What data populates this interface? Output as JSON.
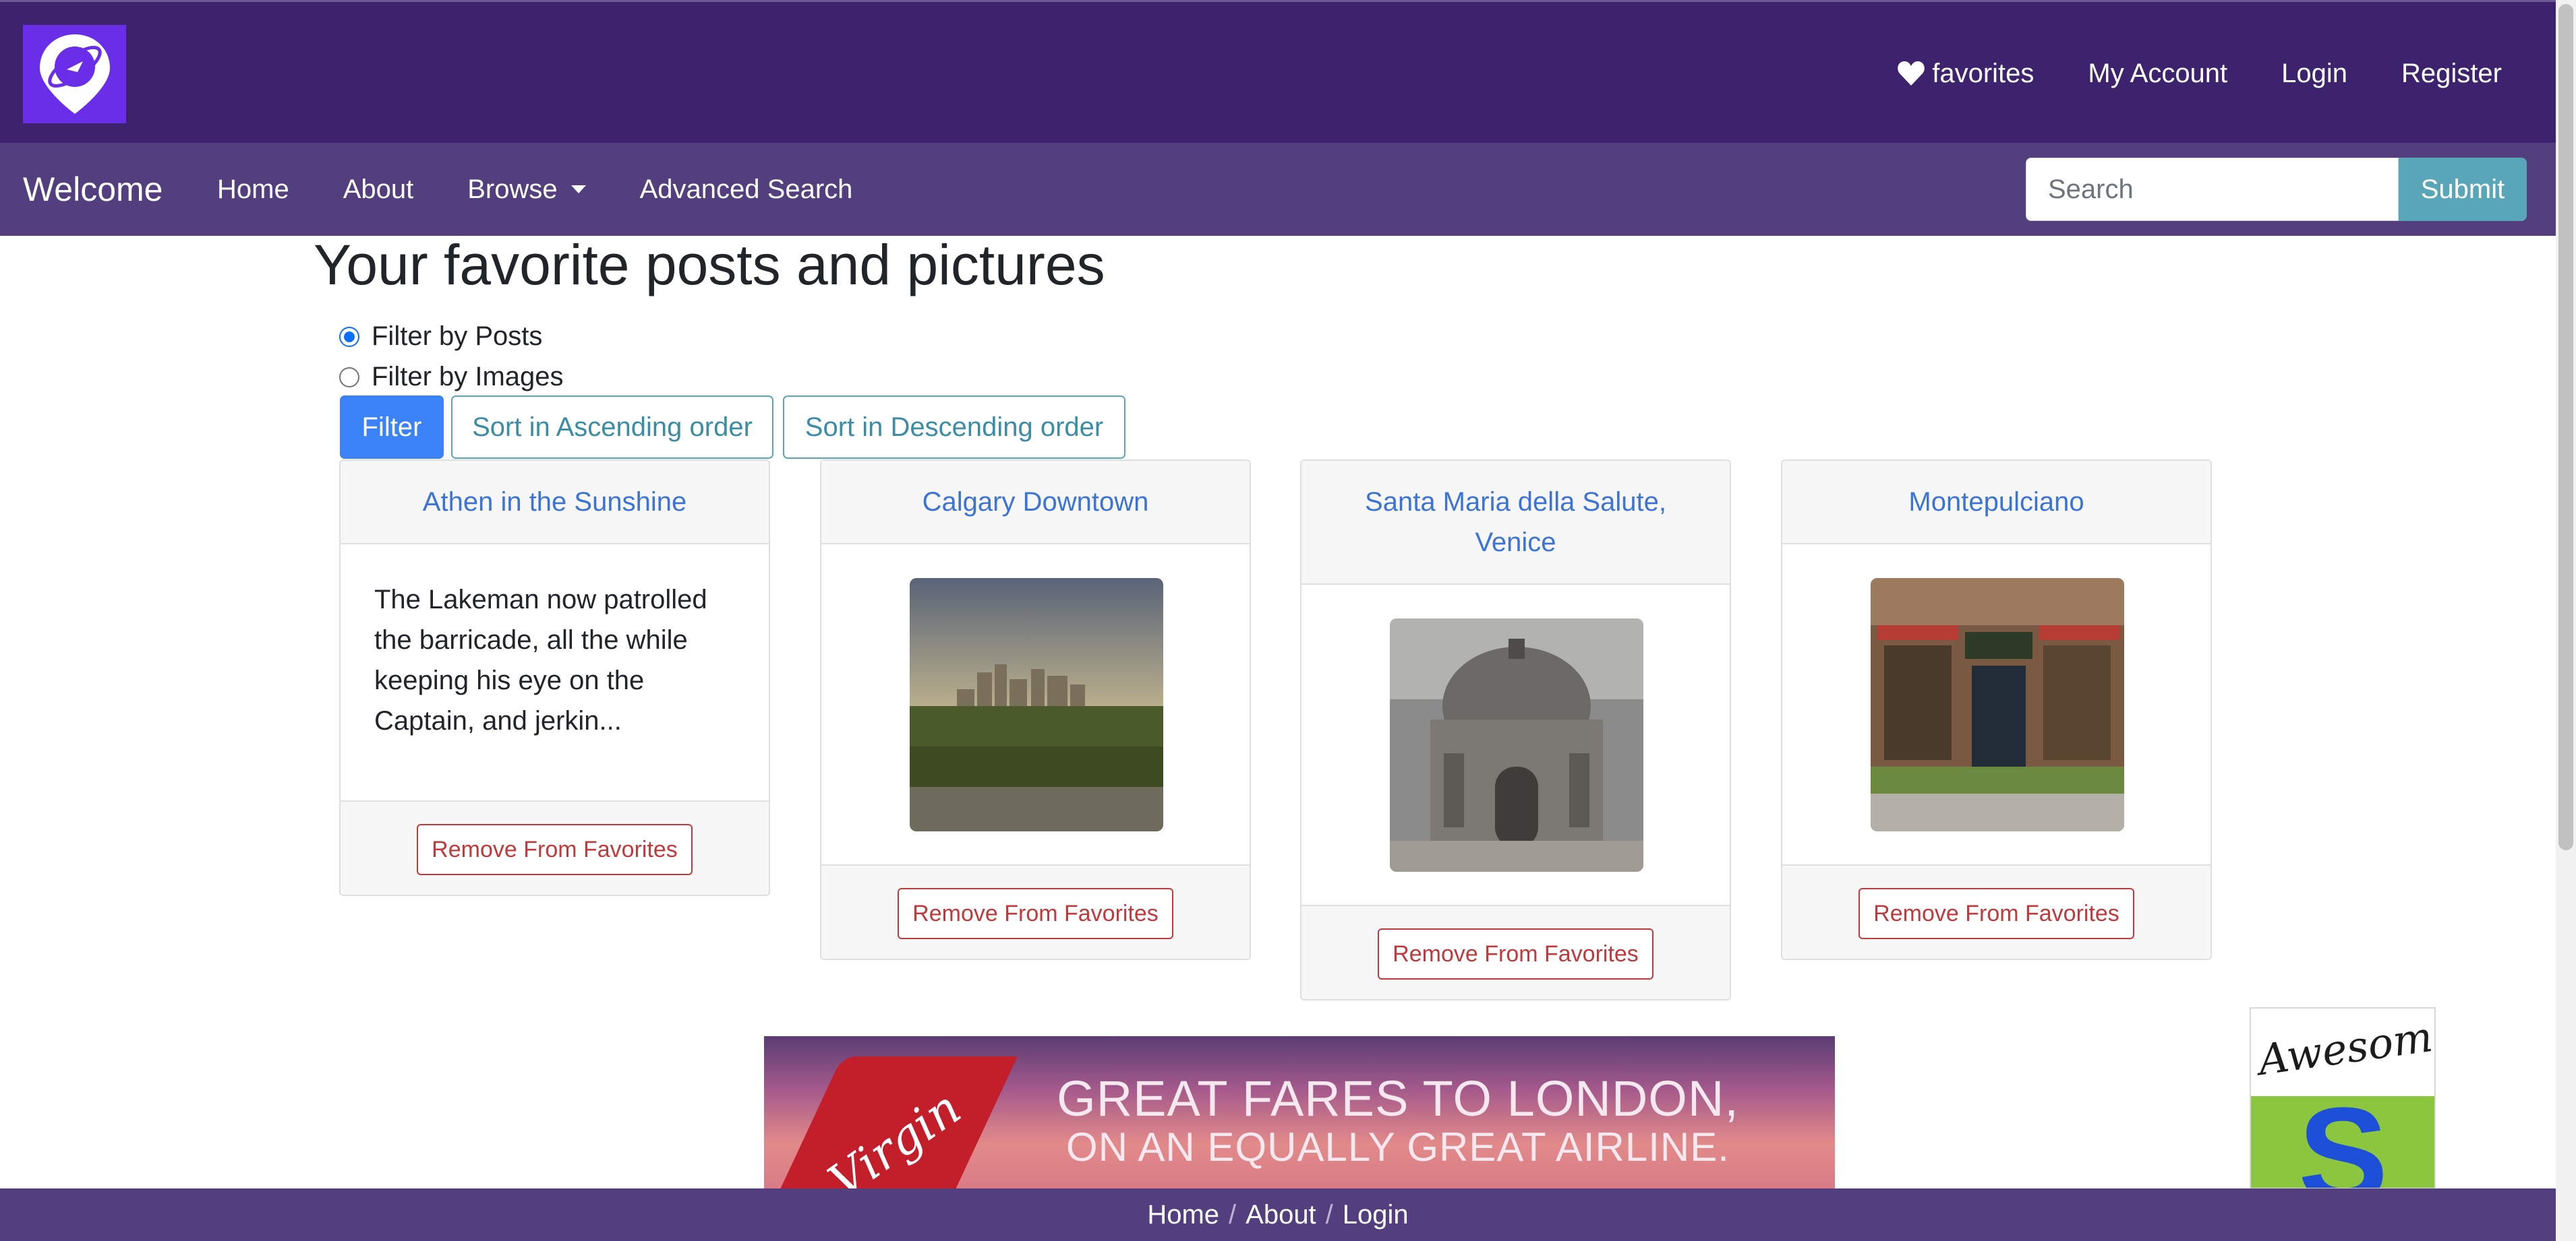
{
  "topbar": {
    "links": [
      {
        "label": "favorites",
        "icon": "heart-icon"
      },
      {
        "label": "My Account"
      },
      {
        "label": "Login"
      },
      {
        "label": "Register"
      }
    ]
  },
  "navbar": {
    "brand": "Welcome",
    "links": [
      "Home",
      "About",
      "Browse",
      "Advanced Search"
    ],
    "search_placeholder": "Search",
    "submit_label": "Submit"
  },
  "main": {
    "title": "Your favorite posts and pictures",
    "radios": [
      {
        "label": "Filter by Posts",
        "checked": true
      },
      {
        "label": "Filter by Images",
        "checked": false
      }
    ],
    "buttons": {
      "filter": "Filter",
      "sort_asc": "Sort in Ascending order",
      "sort_desc": "Sort in Descending order"
    },
    "cards": [
      {
        "title": "Athen in the Sunshine",
        "text": "The Lakeman now patrolled the barricade, all the while keeping his eye on the Captain, and jerkin...",
        "button": "Remove From Favorites"
      },
      {
        "title": "Calgary Downtown",
        "image": "city-skyline-photo",
        "button": "Remove From Favorites"
      },
      {
        "title": "Santa Maria della Salute, Venice",
        "image": "basilica-dome-photo",
        "button": "Remove From Favorites"
      },
      {
        "title": "Montepulciano",
        "image": "wine-bar-storefront-photo",
        "button": "Remove From Favorites"
      }
    ]
  },
  "ads": {
    "banner_line1": "GREAT FARES TO LONDON,",
    "banner_line2": "ON AN EQUALLY GREAT AIRLINE.",
    "banner_brand": "Virgin",
    "side_ad_text": "Awesome",
    "side_ad_letter": "S"
  },
  "footer": {
    "links": [
      "Home",
      "About",
      "Login"
    ],
    "separator": "/"
  },
  "colors": {
    "topbar": "#3d236d",
    "navbar": "#533f7e",
    "accent": "#3b82f6",
    "info": "#58a6b8",
    "danger": "#c0393b"
  }
}
